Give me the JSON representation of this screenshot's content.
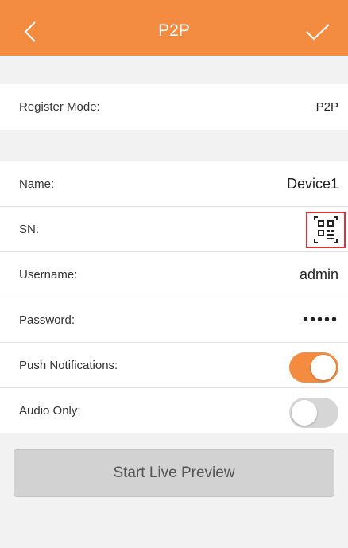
{
  "header": {
    "title": "P2P",
    "back_icon": "chevron-left-icon",
    "confirm_icon": "checkmark-icon",
    "color": "#f38b40"
  },
  "register": {
    "label": "Register Mode:",
    "value": "P2P"
  },
  "fields": {
    "name": {
      "label": "Name:",
      "value": "Device1"
    },
    "sn": {
      "label": "SN:",
      "icon": "qr-scan-icon"
    },
    "username": {
      "label": "Username:",
      "value": "admin"
    },
    "password": {
      "label": "Password:",
      "value": "•••••"
    },
    "push": {
      "label": "Push Notifications:",
      "enabled": true
    },
    "audio": {
      "label": "Audio Only:",
      "enabled": false
    }
  },
  "actions": {
    "start_preview": "Start Live Preview"
  },
  "colors": {
    "accent": "#f38b40",
    "highlight_border": "#e0303a"
  }
}
